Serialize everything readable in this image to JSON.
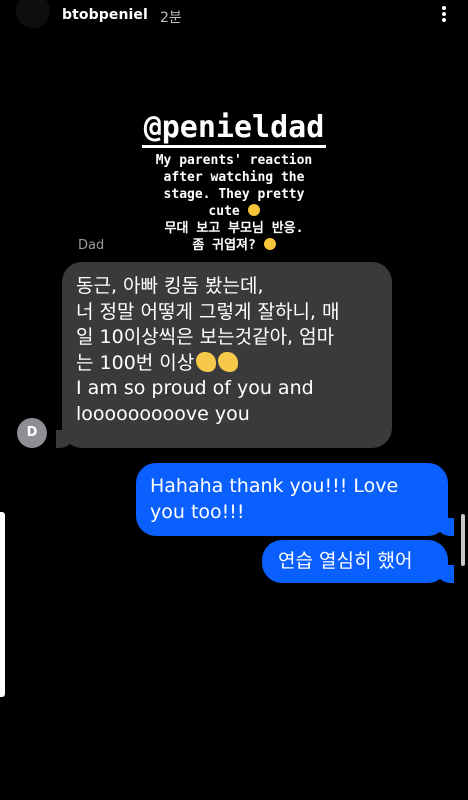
{
  "header": {
    "username": "btobpeniel",
    "time": "2분",
    "more_icon": "vertical-ellipsis-icon"
  },
  "story": {
    "mention": "@penieldad",
    "caption_lines": [
      "My parents' reaction",
      "after watching the",
      "stage. They pretty",
      "cute",
      "무대 보고 부모님 반응.",
      "좀 귀엽져?"
    ],
    "emoji": "smiling-face-emoji"
  },
  "chat": {
    "sender_name": "Dad",
    "avatar_initial": "D",
    "received_lines": [
      "동근, 아빠 킹돔 봤는데,",
      "너 정말 어떻게 그렇게 잘하니, 매",
      "일 10이상씩은 보는것같아, 엄마",
      "는 100번 이상",
      "I am so proud of you and",
      "looooooooove you"
    ],
    "clap_emoji": "clapping-hands-emoji",
    "sent_1": "Hahaha thank you!!! Love you too!!!",
    "sent_2": "연습 열심히 했어"
  },
  "colors": {
    "background": "#000000",
    "received_bubble": "#3a3a3c",
    "sent_bubble": "#0a5fff",
    "avatar": "#8e8e93"
  }
}
